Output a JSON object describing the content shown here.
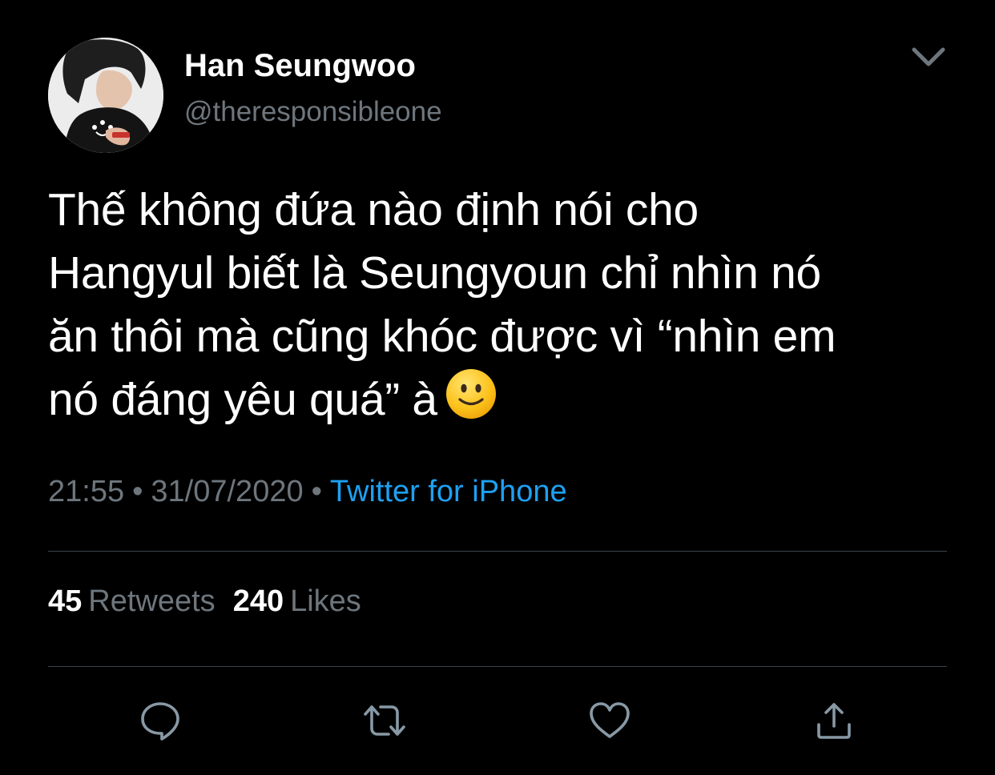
{
  "tweet": {
    "author": {
      "name": "Han Seungwoo",
      "handle": "@theresponsibleone"
    },
    "text_lines": [
      "Thế không đứa nào định nói cho",
      "Hangyul biết là Seungyoun chỉ nhìn nó",
      "ăn thôi mà cũng khóc được vì “nhìn em",
      "nó đáng yêu quá” à"
    ],
    "emoji": "slightly-smiling-face",
    "time": "21:55",
    "date": "31/07/2020",
    "separator": "•",
    "source": "Twitter for iPhone",
    "stats": {
      "retweets_count": "45",
      "retweets_label": "Retweets",
      "likes_count": "240",
      "likes_label": "Likes"
    },
    "actions": [
      "reply-icon",
      "retweet-icon",
      "like-icon",
      "share-icon"
    ]
  },
  "colors": {
    "background": "#000000",
    "text": "#ffffff",
    "secondary": "#6e767d",
    "link": "#1da1f2",
    "divider": "#38444d"
  }
}
